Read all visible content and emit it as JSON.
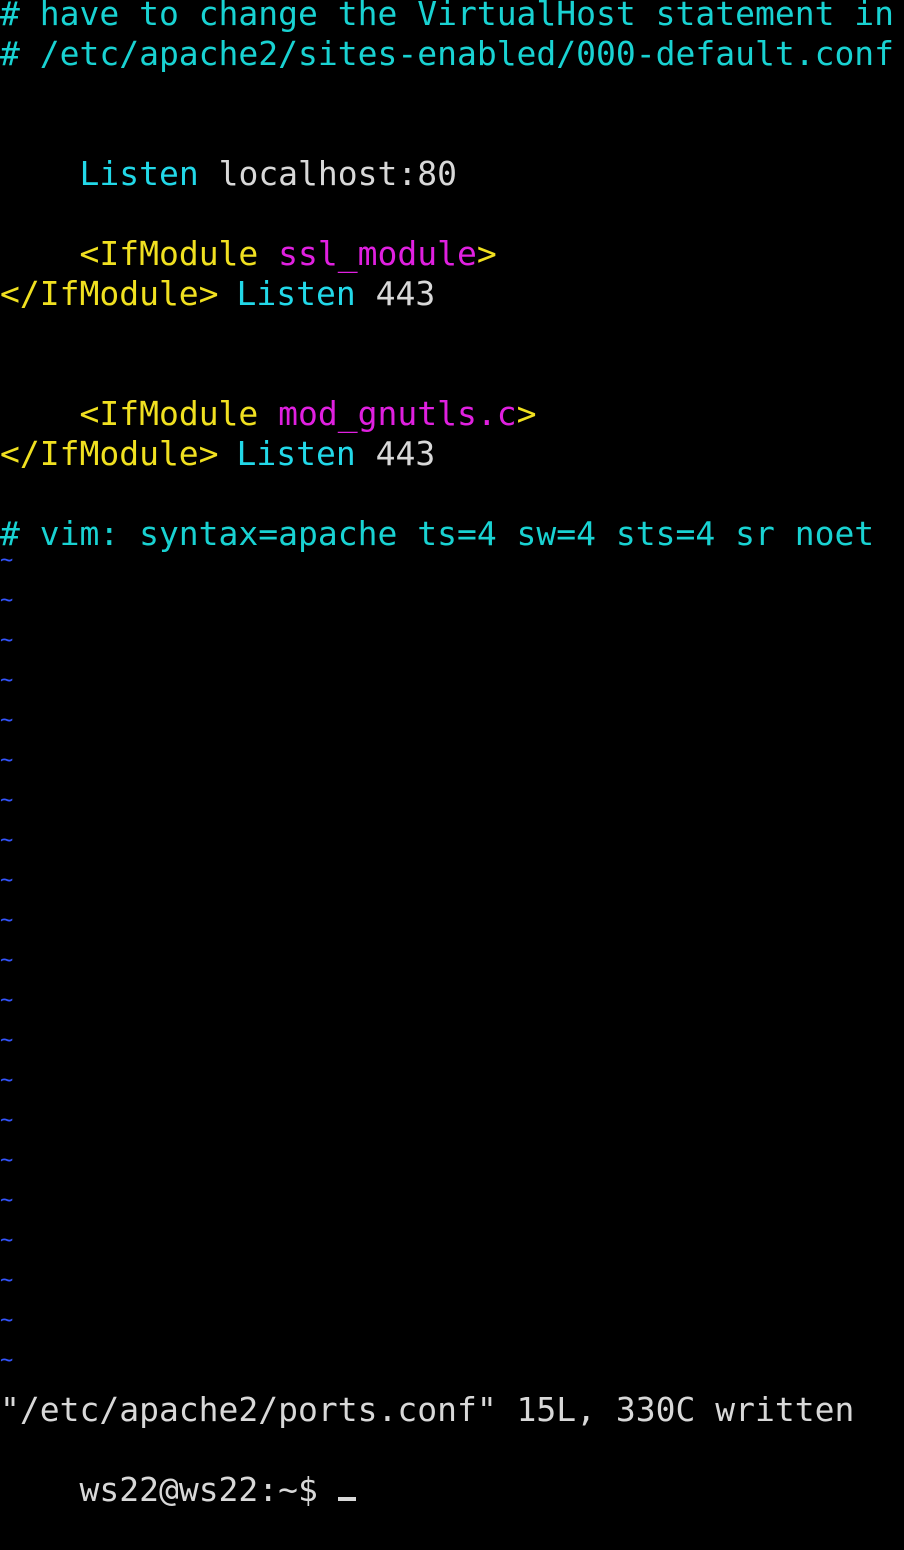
{
  "terminal": {
    "comment_line_1": "# have to change the VirtualHost statement in",
    "comment_line_2": "# /etc/apache2/sites-enabled/000-default.conf",
    "listen_directive": "Listen",
    "listen_address": "localhost:80",
    "ifmodule_1_open": "<IfModule",
    "ifmodule_1_name": "ssl_module",
    "ifmodule_close_bracket": ">",
    "ifmodule_1_listen_indent": "        ",
    "ifmodule_1_listen": "Listen",
    "ifmodule_1_port": "443",
    "ifmodule_1_close": "</IfModule>",
    "ifmodule_2_open": "<IfModule",
    "ifmodule_2_name": "mod_gnutls.c",
    "ifmodule_2_listen": "Listen",
    "ifmodule_2_port": "443",
    "ifmodule_2_close": "</IfModule>",
    "modeline": "# vim: syntax=apache ts=4 sw=4 sts=4 sr noet",
    "tilde_char": "~",
    "status_message": "\"/etc/apache2/ports.conf\" 15L, 330C written",
    "prompt": "ws22@ws22:~$ "
  },
  "colors": {
    "background": "#000000",
    "comment": "#19d2d2",
    "keyword": "#22d8e8",
    "tag": "#f0e020",
    "module": "#e020e0",
    "plain_text": "#d8d8d8",
    "tilde": "#3355ff"
  }
}
